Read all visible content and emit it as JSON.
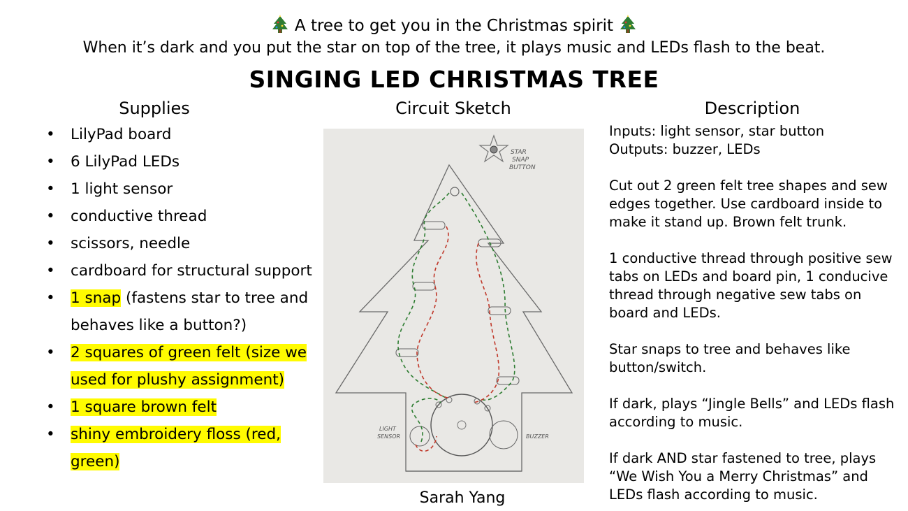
{
  "header": {
    "tagline": "A tree to get you in the Christmas spirit",
    "summary": "When it’s dark and you put the star on top of the tree, it plays music and LEDs flash to the beat.",
    "title": "SINGING LED CHRISTMAS TREE",
    "emoji_icon": "christmas-tree-emoji"
  },
  "columns": {
    "supplies_heading": "Supplies",
    "sketch_heading": "Circuit Sketch",
    "description_heading": "Description"
  },
  "supplies": [
    {
      "text": "LilyPad board",
      "highlight": "",
      "rest": ""
    },
    {
      "text": "6 LilyPad LEDs",
      "highlight": "",
      "rest": ""
    },
    {
      "text": "1 light sensor",
      "highlight": "",
      "rest": ""
    },
    {
      "text": "conductive thread",
      "highlight": "",
      "rest": ""
    },
    {
      "text": "scissors, needle",
      "highlight": "",
      "rest": ""
    },
    {
      "text": "cardboard for structural support",
      "highlight": "",
      "rest": ""
    },
    {
      "text": "",
      "highlight": "1 snap",
      "rest": " (fastens star to tree and behaves like a button?)"
    },
    {
      "text": "",
      "highlight": "2 squares of green felt (size we used for plushy assignment)",
      "rest": ""
    },
    {
      "text": "",
      "highlight": "1 square brown felt",
      "rest": ""
    },
    {
      "text": "",
      "highlight": "shiny embroidery floss (red, green)",
      "rest": ""
    }
  ],
  "bullet": "•",
  "highlight_color": "#fffb00",
  "sketch": {
    "label_star": "STAR",
    "label_snap": "SNAP",
    "label_button": "BUTTON",
    "label_light": "LIGHT",
    "label_sensor": "SENSOR",
    "label_buzzer": "BUZZER",
    "thread_colors": {
      "positive": "#c0392b",
      "negative": "#2e7d32"
    }
  },
  "author": "Sarah Yang",
  "description": [
    [
      "Inputs: light sensor, star button",
      "Outputs: buzzer, LEDs"
    ],
    [
      "Cut out 2 green felt tree shapes and sew edges together. Use cardboard inside to make it stand up. Brown felt trunk."
    ],
    [
      "1 conductive thread through positive sew tabs on LEDs and board pin, 1 conducive thread through negative sew tabs on board and LEDs."
    ],
    [
      "Star snaps to tree and behaves like button/switch."
    ],
    [
      "If dark, plays “Jingle Bells” and LEDs flash according to music."
    ],
    [
      "If dark AND star fastened to tree, plays “We Wish You a Merry Christmas” and LEDs flash according to music."
    ]
  ]
}
